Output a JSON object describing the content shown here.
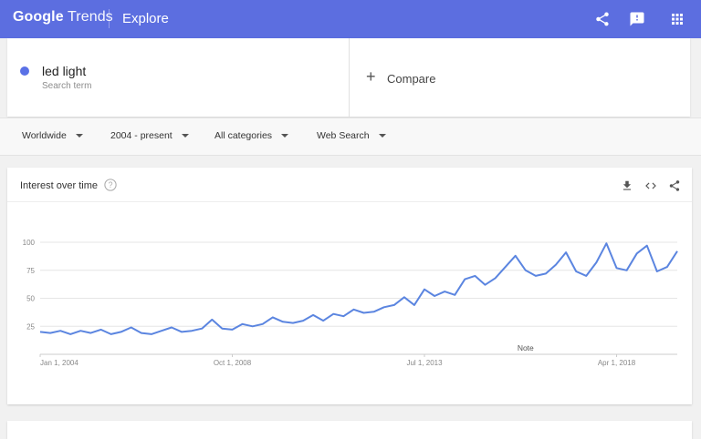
{
  "header": {
    "brand_google": "Google",
    "brand_trends": "Trends",
    "page_name": "Explore",
    "icons": [
      "share-icon",
      "feedback-icon",
      "apps-icon"
    ]
  },
  "search": {
    "term": "led light",
    "term_type": "Search term",
    "compare_label": "Compare",
    "term_color": "#5a71e6"
  },
  "filters": {
    "region": "Worldwide",
    "time": "2004 - present",
    "category": "All categories",
    "search_type": "Web Search"
  },
  "interest_card": {
    "title": "Interest over time",
    "tools": [
      "download-icon",
      "embed-icon",
      "share-icon"
    ]
  },
  "chart_data": {
    "type": "line",
    "title": "Interest over time",
    "ylim": [
      0,
      100
    ],
    "y_ticks": [
      "100",
      "75",
      "50",
      "25"
    ],
    "x_ticks": [
      "Jan 1, 2004",
      "Oct 1, 2008",
      "Jul 1, 2013",
      "Apr 1, 2018"
    ],
    "annotation": "Note",
    "grid": true,
    "line_color": "#5b85e0",
    "series": [
      {
        "x": [
          2004.0,
          2004.25,
          2004.5,
          2004.75,
          2005.0,
          2005.25,
          2005.5,
          2005.75,
          2006.0,
          2006.25,
          2006.5,
          2006.75,
          2007.0,
          2007.25,
          2007.5,
          2007.75,
          2008.0,
          2008.25,
          2008.5,
          2008.75,
          2009.0,
          2009.25,
          2009.5,
          2009.75,
          2010.0,
          2010.25,
          2010.5,
          2010.75,
          2011.0,
          2011.25,
          2011.5,
          2011.75,
          2012.0,
          2012.25,
          2012.5,
          2012.75,
          2013.0,
          2013.25,
          2013.5,
          2013.75,
          2014.0,
          2014.25,
          2014.5,
          2014.75,
          2015.0,
          2015.25,
          2015.5,
          2015.75,
          2016.0,
          2016.25,
          2016.5,
          2016.75,
          2017.0,
          2017.25,
          2017.5,
          2017.75,
          2018.0,
          2018.25,
          2018.5,
          2018.75,
          2019.0,
          2019.25,
          2019.5,
          2019.75
        ],
        "values": [
          20,
          19,
          21,
          18,
          21,
          19,
          22,
          18,
          20,
          24,
          19,
          18,
          21,
          24,
          20,
          21,
          23,
          31,
          23,
          22,
          27,
          25,
          27,
          33,
          29,
          28,
          30,
          35,
          30,
          36,
          34,
          40,
          37,
          38,
          42,
          44,
          51,
          44,
          58,
          52,
          56,
          53,
          67,
          70,
          62,
          68,
          78,
          88,
          75,
          70,
          72,
          80,
          91,
          74,
          70,
          82,
          99,
          77,
          75,
          90,
          97,
          74,
          78,
          92
        ]
      }
    ]
  },
  "second_card": {}
}
